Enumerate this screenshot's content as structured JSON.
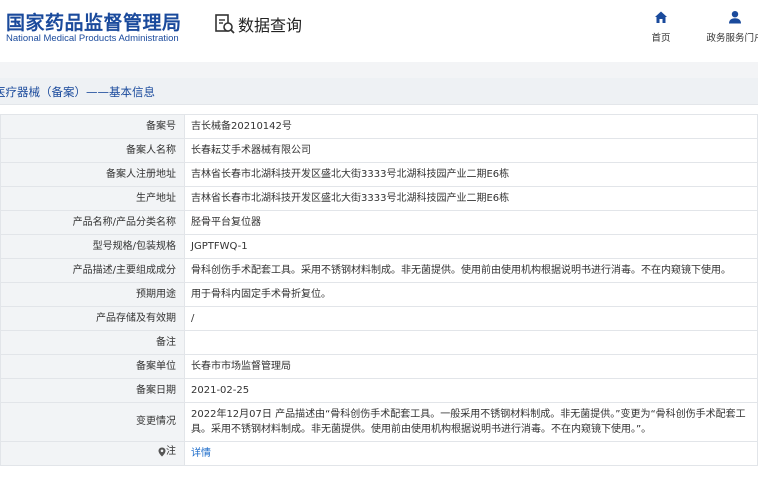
{
  "header": {
    "logo_cn": "国家药品监督管理局",
    "logo_en": "National Medical Products Administration",
    "search_title": "数据查询",
    "nav": [
      {
        "label": "首页",
        "icon": "home-icon"
      },
      {
        "label": "政务服务门户",
        "icon": "user-icon"
      }
    ]
  },
  "breadcrumb": "医疗器械（备案）——基本信息",
  "colors": {
    "brand": "#1a4a9c",
    "link": "#1a6ac9",
    "label_bg": "#f2f4f6"
  },
  "rows": [
    {
      "label": "备案号",
      "value": "吉长械备20210142号"
    },
    {
      "label": "备案人名称",
      "value": "长春耘艾手术器械有限公司"
    },
    {
      "label": "备案人注册地址",
      "value": "吉林省长春市北湖科技开发区盛北大街3333号北湖科技园产业二期E6栋"
    },
    {
      "label": "生产地址",
      "value": "吉林省长春市北湖科技开发区盛北大街3333号北湖科技园产业二期E6栋"
    },
    {
      "label": "产品名称/产品分类名称",
      "value": "胫骨平台复位器"
    },
    {
      "label": "型号规格/包装规格",
      "value": "JGPTFWQ-1"
    },
    {
      "label": "产品描述/主要组成成分",
      "value": "骨科创伤手术配套工具。采用不锈钢材料制成。非无菌提供。使用前由使用机构根据说明书进行消毒。不在内窥镜下使用。"
    },
    {
      "label": "预期用途",
      "value": "用于骨科内固定手术骨折复位。"
    },
    {
      "label": "产品存储及有效期",
      "value": "/"
    },
    {
      "label": "备注",
      "value": ""
    },
    {
      "label": "备案单位",
      "value": "长春市市场监督管理局"
    },
    {
      "label": "备案日期",
      "value": "2021-02-25"
    },
    {
      "label": "变更情况",
      "value": "2022年12月07日 产品描述由“骨科创伤手术配套工具。一般采用不锈钢材料制成。非无菌提供。”变更为“骨科创伤手术配套工具。采用不锈钢材料制成。非无菌提供。使用前由使用机构根据说明书进行消毒。不在内窥镜下使用。”。"
    }
  ],
  "note_row": {
    "label": "注",
    "link_text": "详情",
    "icon": "pin-icon"
  }
}
